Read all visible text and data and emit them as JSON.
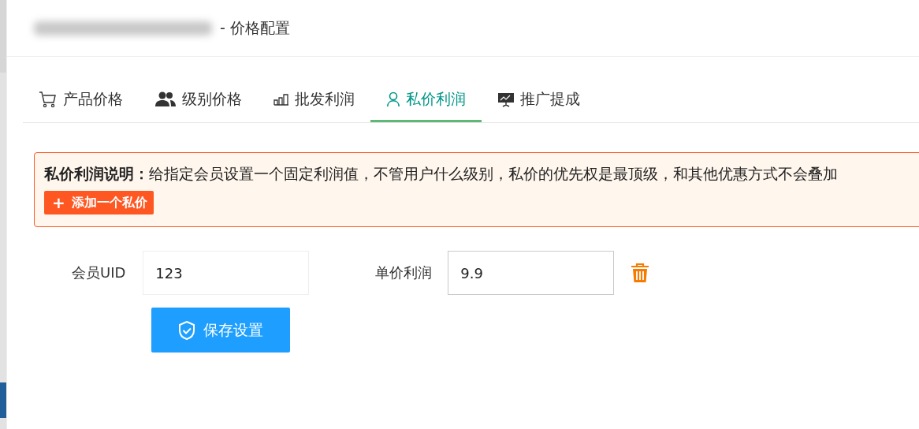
{
  "window": {
    "title": "- 价格配置"
  },
  "tabs": [
    {
      "label": "产品价格",
      "kind": "cart",
      "selected": false
    },
    {
      "label": "级别价格",
      "kind": "users",
      "selected": false
    },
    {
      "label": "批发利润",
      "kind": "bars",
      "selected": false
    },
    {
      "label": "私价利润",
      "kind": "user",
      "selected": true
    },
    {
      "label": "推广提成",
      "kind": "board",
      "selected": false
    }
  ],
  "notice": {
    "heading": "私价利润说明：",
    "text": "给指定会员设置一个固定利润值，不管用户什么级别，私价的优先权是最顶级，和其他优惠方式不会叠加"
  },
  "add_button": {
    "icon": "+",
    "label": "添加一个私价"
  },
  "fields": [
    {
      "label": "会员UID",
      "value": "123",
      "focused": false
    },
    {
      "label": "单价利润",
      "value": "9.9",
      "focused": true
    }
  ],
  "save_button": {
    "label": "保存设置"
  }
}
